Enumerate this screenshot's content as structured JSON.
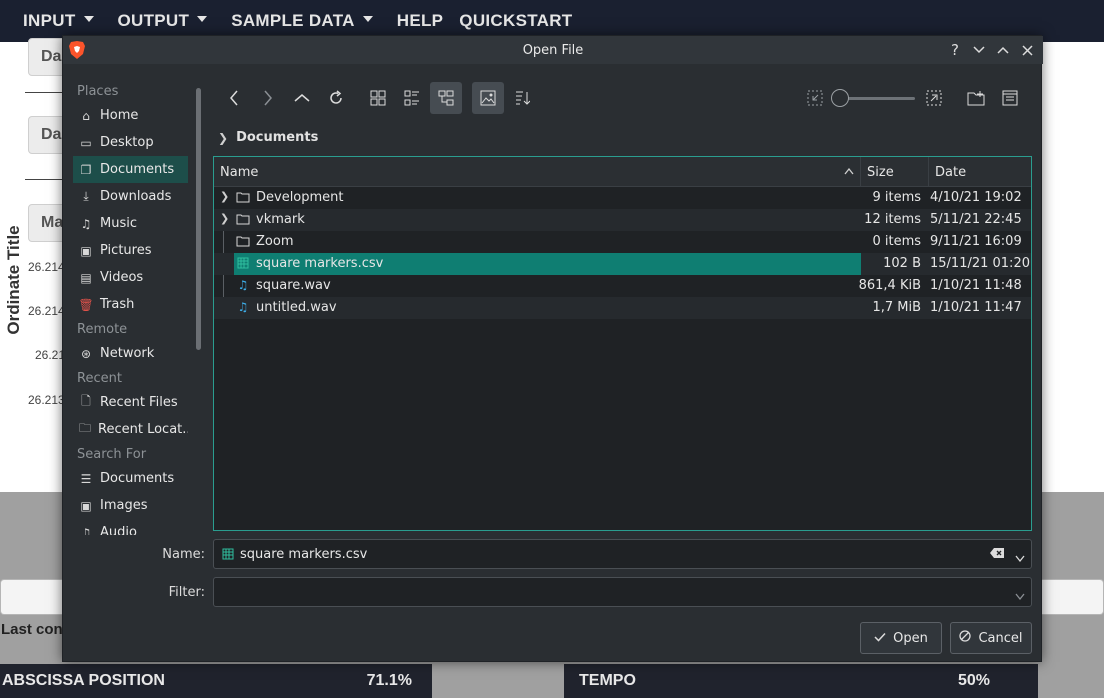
{
  "app_menubar": {
    "items": [
      {
        "label": "INPUT",
        "caret": true
      },
      {
        "label": "OUTPUT",
        "caret": true
      },
      {
        "label": "SAMPLE DATA",
        "caret": true
      },
      {
        "label": "HELP",
        "caret": false
      },
      {
        "label": "QUICKSTART",
        "caret": false
      }
    ]
  },
  "background": {
    "buttons": [
      "Da",
      "Da",
      "Ma"
    ],
    "ordinate_title": "Ordinate Title",
    "ticks": [
      "26.214",
      "26.214",
      "26.21",
      "26.213"
    ],
    "last_con": "Last con",
    "abscissa_label": "ABSCISSA POSITION",
    "abscissa_value": "71.1%",
    "tempo_label": "TEMPO",
    "tempo_value": "50%"
  },
  "dialog": {
    "title": "Open File",
    "title_buttons": [
      "?",
      "⌄",
      "⌃",
      "✕"
    ],
    "places": {
      "sections": [
        {
          "header": "Places",
          "items": [
            {
              "label": "Home",
              "icon": "home-icon"
            },
            {
              "label": "Desktop",
              "icon": "desktop-icon"
            },
            {
              "label": "Documents",
              "icon": "documents-icon",
              "selected": true
            },
            {
              "label": "Downloads",
              "icon": "downloads-icon"
            },
            {
              "label": "Music",
              "icon": "music-icon"
            },
            {
              "label": "Pictures",
              "icon": "pictures-icon"
            },
            {
              "label": "Videos",
              "icon": "videos-icon"
            },
            {
              "label": "Trash",
              "icon": "trash-icon"
            }
          ]
        },
        {
          "header": "Remote",
          "items": [
            {
              "label": "Network",
              "icon": "network-icon"
            }
          ]
        },
        {
          "header": "Recent",
          "items": [
            {
              "label": "Recent Files",
              "icon": "recent-files-icon"
            },
            {
              "label": "Recent Locat...",
              "icon": "recent-locations-icon"
            }
          ]
        },
        {
          "header": "Search For",
          "items": [
            {
              "label": "Documents",
              "icon": "search-documents-icon"
            },
            {
              "label": "Images",
              "icon": "search-images-icon"
            },
            {
              "label": "Audio",
              "icon": "search-audio-icon"
            }
          ]
        }
      ]
    },
    "breadcrumb": "Documents",
    "columns": {
      "name": "Name",
      "size": "Size",
      "date": "Date"
    },
    "files": [
      {
        "name": "Development",
        "size": "9 items",
        "date": "4/10/21 19:02",
        "type": "folder",
        "expandable": true
      },
      {
        "name": "vkmark",
        "size": "12 items",
        "date": "5/11/21 22:45",
        "type": "folder",
        "expandable": true
      },
      {
        "name": "Zoom",
        "size": "0 items",
        "date": "9/11/21 16:09",
        "type": "folder",
        "expandable": false
      },
      {
        "name": "square markers.csv",
        "size": "102 B",
        "date": "15/11/21 01:20",
        "type": "csv",
        "selected": true
      },
      {
        "name": "square.wav",
        "size": "861,4 KiB",
        "date": "1/10/21 11:48",
        "type": "audio"
      },
      {
        "name": "untitled.wav",
        "size": "1,7 MiB",
        "date": "1/10/21 11:47",
        "type": "audio"
      }
    ],
    "name_label": "Name:",
    "name_value": "square markers.csv",
    "filter_label": "Filter:",
    "filter_value": "",
    "open_label": "Open",
    "cancel_label": "Cancel",
    "accent_color": "#2a9d8f",
    "selection_color": "#0f7e72"
  }
}
